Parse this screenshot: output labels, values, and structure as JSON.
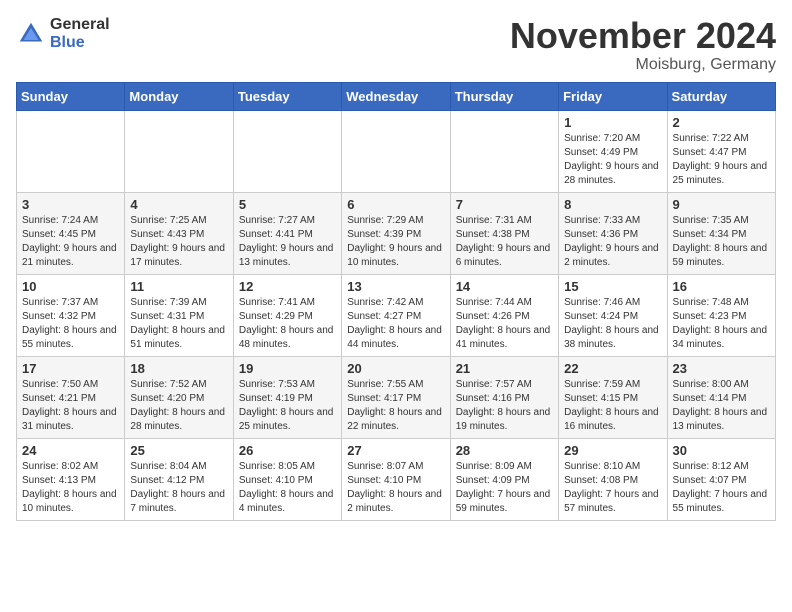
{
  "header": {
    "logo_general": "General",
    "logo_blue": "Blue",
    "month_title": "November 2024",
    "location": "Moisburg, Germany"
  },
  "days_of_week": [
    "Sunday",
    "Monday",
    "Tuesday",
    "Wednesday",
    "Thursday",
    "Friday",
    "Saturday"
  ],
  "weeks": [
    [
      {
        "day": "",
        "info": ""
      },
      {
        "day": "",
        "info": ""
      },
      {
        "day": "",
        "info": ""
      },
      {
        "day": "",
        "info": ""
      },
      {
        "day": "",
        "info": ""
      },
      {
        "day": "1",
        "info": "Sunrise: 7:20 AM\nSunset: 4:49 PM\nDaylight: 9 hours and 28 minutes."
      },
      {
        "day": "2",
        "info": "Sunrise: 7:22 AM\nSunset: 4:47 PM\nDaylight: 9 hours and 25 minutes."
      }
    ],
    [
      {
        "day": "3",
        "info": "Sunrise: 7:24 AM\nSunset: 4:45 PM\nDaylight: 9 hours and 21 minutes."
      },
      {
        "day": "4",
        "info": "Sunrise: 7:25 AM\nSunset: 4:43 PM\nDaylight: 9 hours and 17 minutes."
      },
      {
        "day": "5",
        "info": "Sunrise: 7:27 AM\nSunset: 4:41 PM\nDaylight: 9 hours and 13 minutes."
      },
      {
        "day": "6",
        "info": "Sunrise: 7:29 AM\nSunset: 4:39 PM\nDaylight: 9 hours and 10 minutes."
      },
      {
        "day": "7",
        "info": "Sunrise: 7:31 AM\nSunset: 4:38 PM\nDaylight: 9 hours and 6 minutes."
      },
      {
        "day": "8",
        "info": "Sunrise: 7:33 AM\nSunset: 4:36 PM\nDaylight: 9 hours and 2 minutes."
      },
      {
        "day": "9",
        "info": "Sunrise: 7:35 AM\nSunset: 4:34 PM\nDaylight: 8 hours and 59 minutes."
      }
    ],
    [
      {
        "day": "10",
        "info": "Sunrise: 7:37 AM\nSunset: 4:32 PM\nDaylight: 8 hours and 55 minutes."
      },
      {
        "day": "11",
        "info": "Sunrise: 7:39 AM\nSunset: 4:31 PM\nDaylight: 8 hours and 51 minutes."
      },
      {
        "day": "12",
        "info": "Sunrise: 7:41 AM\nSunset: 4:29 PM\nDaylight: 8 hours and 48 minutes."
      },
      {
        "day": "13",
        "info": "Sunrise: 7:42 AM\nSunset: 4:27 PM\nDaylight: 8 hours and 44 minutes."
      },
      {
        "day": "14",
        "info": "Sunrise: 7:44 AM\nSunset: 4:26 PM\nDaylight: 8 hours and 41 minutes."
      },
      {
        "day": "15",
        "info": "Sunrise: 7:46 AM\nSunset: 4:24 PM\nDaylight: 8 hours and 38 minutes."
      },
      {
        "day": "16",
        "info": "Sunrise: 7:48 AM\nSunset: 4:23 PM\nDaylight: 8 hours and 34 minutes."
      }
    ],
    [
      {
        "day": "17",
        "info": "Sunrise: 7:50 AM\nSunset: 4:21 PM\nDaylight: 8 hours and 31 minutes."
      },
      {
        "day": "18",
        "info": "Sunrise: 7:52 AM\nSunset: 4:20 PM\nDaylight: 8 hours and 28 minutes."
      },
      {
        "day": "19",
        "info": "Sunrise: 7:53 AM\nSunset: 4:19 PM\nDaylight: 8 hours and 25 minutes."
      },
      {
        "day": "20",
        "info": "Sunrise: 7:55 AM\nSunset: 4:17 PM\nDaylight: 8 hours and 22 minutes."
      },
      {
        "day": "21",
        "info": "Sunrise: 7:57 AM\nSunset: 4:16 PM\nDaylight: 8 hours and 19 minutes."
      },
      {
        "day": "22",
        "info": "Sunrise: 7:59 AM\nSunset: 4:15 PM\nDaylight: 8 hours and 16 minutes."
      },
      {
        "day": "23",
        "info": "Sunrise: 8:00 AM\nSunset: 4:14 PM\nDaylight: 8 hours and 13 minutes."
      }
    ],
    [
      {
        "day": "24",
        "info": "Sunrise: 8:02 AM\nSunset: 4:13 PM\nDaylight: 8 hours and 10 minutes."
      },
      {
        "day": "25",
        "info": "Sunrise: 8:04 AM\nSunset: 4:12 PM\nDaylight: 8 hours and 7 minutes."
      },
      {
        "day": "26",
        "info": "Sunrise: 8:05 AM\nSunset: 4:10 PM\nDaylight: 8 hours and 4 minutes."
      },
      {
        "day": "27",
        "info": "Sunrise: 8:07 AM\nSunset: 4:10 PM\nDaylight: 8 hours and 2 minutes."
      },
      {
        "day": "28",
        "info": "Sunrise: 8:09 AM\nSunset: 4:09 PM\nDaylight: 7 hours and 59 minutes."
      },
      {
        "day": "29",
        "info": "Sunrise: 8:10 AM\nSunset: 4:08 PM\nDaylight: 7 hours and 57 minutes."
      },
      {
        "day": "30",
        "info": "Sunrise: 8:12 AM\nSunset: 4:07 PM\nDaylight: 7 hours and 55 minutes."
      }
    ]
  ]
}
